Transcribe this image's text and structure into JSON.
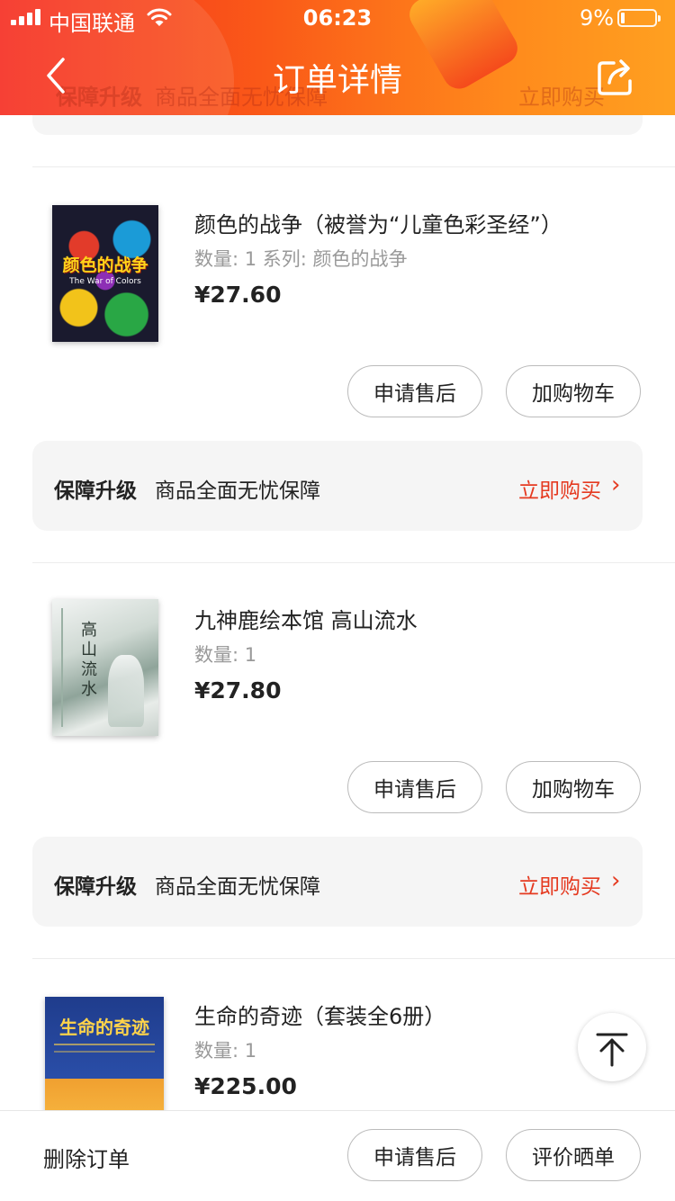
{
  "status_bar": {
    "carrier": "中国联通",
    "time": "06:23",
    "battery_percent": "9%"
  },
  "nav": {
    "title": "订单详情"
  },
  "header_ghost": {
    "left_key": "保障升级",
    "left_value": "商品全面无忧保障",
    "right_action": "立即购买"
  },
  "items": [
    {
      "title": "颜色的战争（被誉为“儿童色彩圣经”）",
      "meta": "数量: 1  系列: 颜色的战争",
      "price": "¥27.60",
      "cover_text": "颜色的战争",
      "cover_subtext": "The War of Colors",
      "buttons": [
        "申请售后",
        "加购物车"
      ],
      "protection": {
        "key": "保障升级",
        "value": "商品全面无忧保障",
        "action": "立即购买",
        "chevron": "›"
      }
    },
    {
      "title": "九神鹿绘本馆 高山流水",
      "meta": "数量: 1",
      "price": "¥27.80",
      "cover_text": "高山流水",
      "buttons": [
        "申请售后",
        "加购物车"
      ],
      "protection": {
        "key": "保障升级",
        "value": "商品全面无忧保障",
        "action": "立即购买",
        "chevron": "›"
      }
    },
    {
      "title": "生命的奇迹（套装全6册）",
      "meta": "数量: 1",
      "price": "¥225.00",
      "cover_text": "生命的奇迹"
    }
  ],
  "bottom_bar": {
    "delete_label": "删除订单",
    "after_sale_label": "申请售后",
    "review_label": "评价晒单"
  },
  "colors": {
    "accent": "#e53a20",
    "header_start": "#f52b1f",
    "header_end": "#ffa020"
  }
}
